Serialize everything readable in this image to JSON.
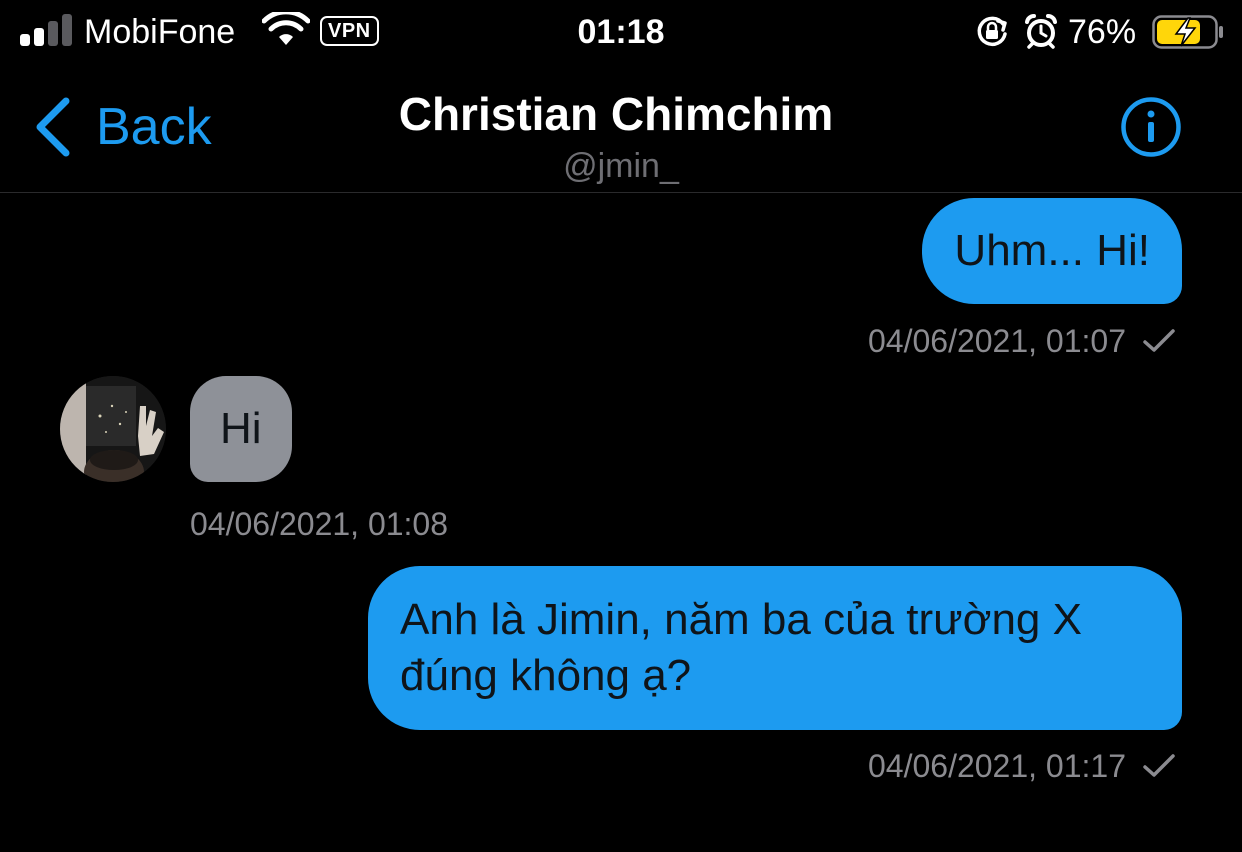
{
  "status_bar": {
    "carrier": "MobiFone",
    "vpn": "VPN",
    "time": "01:18",
    "battery_percent": "76%",
    "icons": [
      "signal-icon",
      "wifi-icon",
      "vpn-badge",
      "rotation-lock-icon",
      "alarm-icon",
      "battery-charging-icon"
    ],
    "signal_bars_filled": 2,
    "signal_bars_total": 4,
    "battery_level": 0.76,
    "battery_color": "#ffd60a"
  },
  "header": {
    "back_label": "Back",
    "title": "Christian Chimchim",
    "handle": "@jmin_",
    "icons": [
      "chevron-left-icon",
      "info-icon"
    ]
  },
  "colors": {
    "accent": "#1d9bf0",
    "sent_bubble": "#1d9bf0",
    "received_bubble": "#8e9198",
    "background": "#000000",
    "meta_text": "#8b8b90"
  },
  "messages": [
    {
      "direction": "sent",
      "text": "Uhm... Hi!",
      "timestamp": "04/06/2021, 01:07",
      "status_icon": "checkmark-icon"
    },
    {
      "direction": "received",
      "text": "Hi",
      "timestamp": "04/06/2021, 01:08",
      "avatar_icon": "avatar"
    },
    {
      "direction": "sent",
      "text": "Anh là Jimin, năm ba của trường X đúng không ạ?",
      "timestamp": "04/06/2021, 01:17",
      "status_icon": "checkmark-icon"
    }
  ]
}
